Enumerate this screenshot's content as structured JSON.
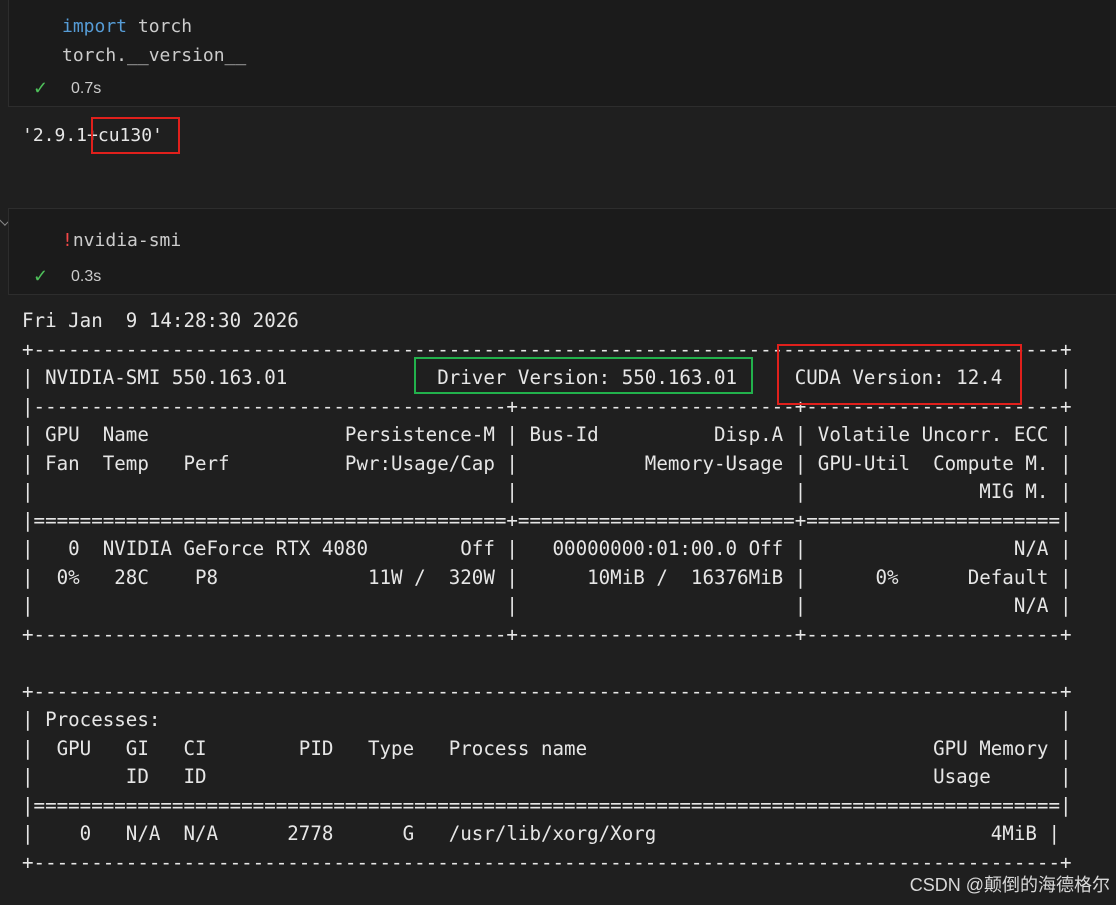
{
  "cells": [
    {
      "code_lines": [
        {
          "keyword": "import",
          "rest": " torch"
        },
        {
          "keyword": "",
          "rest": "torch.__version__"
        }
      ],
      "status": {
        "icon": "check-icon",
        "glyph": "✓",
        "time": "0.7s"
      },
      "output": [
        "'2.9.1+cu130'"
      ]
    },
    {
      "code_lines": [
        {
          "bang": "!",
          "rest": "nvidia-smi"
        }
      ],
      "status": {
        "icon": "check-icon",
        "glyph": "✓",
        "time": "0.3s"
      },
      "output": [
        "Fri Jan  9 14:28:30 2026",
        "+-----------------------------------------------------------------------------------------+",
        "| NVIDIA-SMI 550.163.01             Driver Version: 550.163.01     CUDA Version: 12.4     |",
        "|-----------------------------------------+------------------------+----------------------+",
        "| GPU  Name                 Persistence-M | Bus-Id          Disp.A | Volatile Uncorr. ECC |",
        "| Fan  Temp   Perf          Pwr:Usage/Cap |           Memory-Usage | GPU-Util  Compute M. |",
        "|                                         |                        |               MIG M. |",
        "|=========================================+========================+======================|",
        "|   0  NVIDIA GeForce RTX 4080        Off |   00000000:01:00.0 Off |                  N/A |",
        "|  0%   28C    P8             11W /  320W |      10MiB /  16376MiB |      0%      Default |",
        "|                                         |                        |                  N/A |",
        "+-----------------------------------------+------------------------+----------------------+",
        "",
        "+-----------------------------------------------------------------------------------------+",
        "| Processes:                                                                              |",
        "|  GPU   GI   CI        PID   Type   Process name                              GPU Memory |",
        "|        ID   ID                                                               Usage      |",
        "|=========================================================================================|",
        "|    0   N/A  N/A      2778      G   /usr/lib/xorg/Xorg                             4MiB |",
        "+-----------------------------------------------------------------------------------------+"
      ]
    }
  ],
  "highlights": {
    "red": "#e0201c",
    "green": "#22b14c"
  },
  "watermark": "CSDN @颠倒的海德格尔"
}
